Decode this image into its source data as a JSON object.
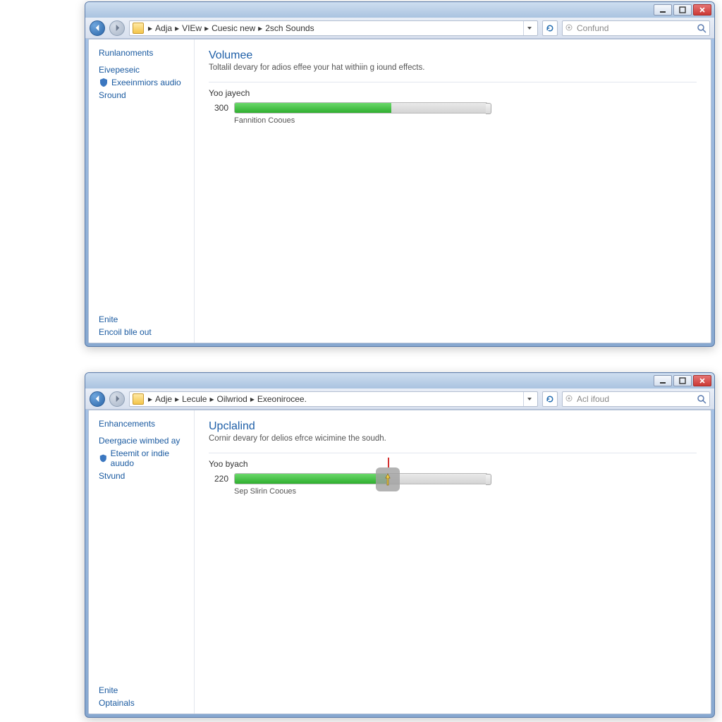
{
  "window_a": {
    "breadcrumb": [
      "Adja",
      "VIEw",
      "Cuesic new",
      "2sch Sounds"
    ],
    "search_placeholder": "Confund",
    "sidebar": {
      "heading": "Runlanoments",
      "links": [
        "Eivepeseic",
        "Exeeinmiors audio",
        "Sround"
      ],
      "bottom": [
        "Enite",
        "Encoil blle out"
      ]
    },
    "content": {
      "title": "Volumee",
      "subtitle": "Toltalil devary for adios effee your hat withiin g iound effects.",
      "label": "Yoo jayech",
      "value": "300",
      "fill_pct": 62,
      "caption": "Fannition Cooues"
    }
  },
  "window_b": {
    "breadcrumb": [
      "Adje",
      "Lecule",
      "Oilwriod",
      "Exeonirocee."
    ],
    "search_placeholder": "Acl ifoud",
    "sidebar": {
      "heading": "Enhancements",
      "links": [
        "Deergacie wimbed ay",
        "Eteemit or indie auudo",
        "Stvund"
      ],
      "bottom": [
        "Enite",
        "Optainals"
      ]
    },
    "content": {
      "title": "Upclalind",
      "subtitle": "Cornir devary for delios efrce wicimine the soudh.",
      "label": "Yoo byach",
      "value": "220",
      "fill_pct": 60,
      "caption": "Sep Slirin Cooues"
    }
  }
}
